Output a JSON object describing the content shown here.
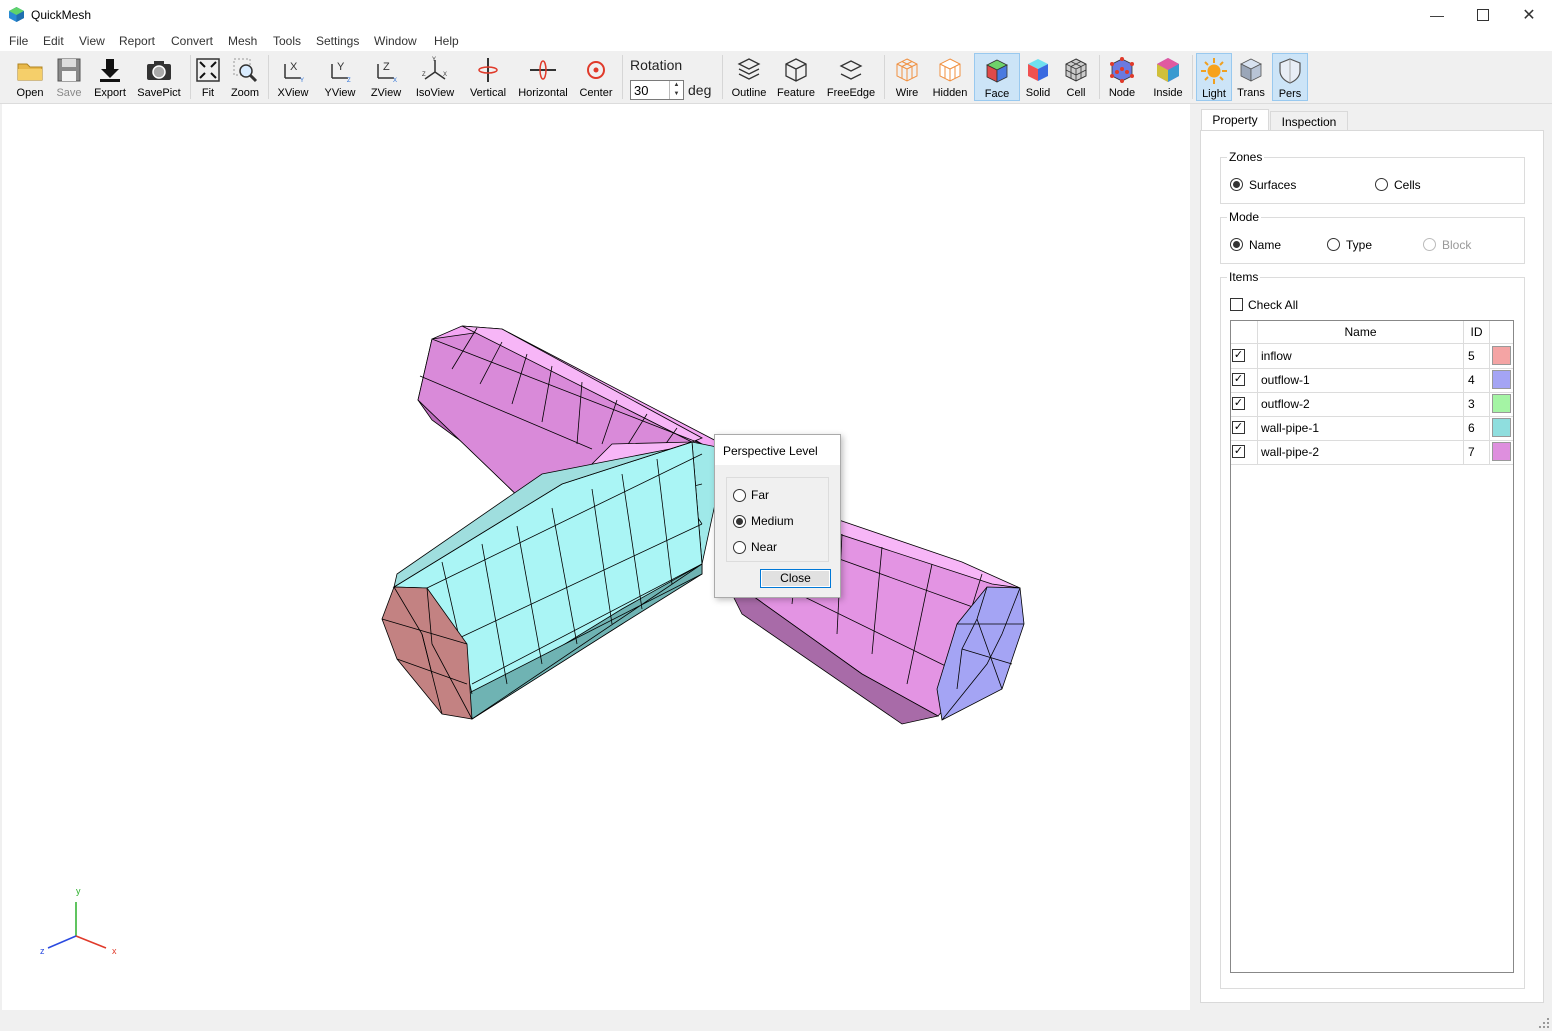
{
  "window": {
    "title": "QuickMesh",
    "min_icon": "minimize-icon",
    "max_icon": "maximize-icon",
    "close_icon": "close-icon"
  },
  "menu": [
    "File",
    "Edit",
    "View",
    "Report",
    "Convert",
    "Mesh",
    "Tools",
    "Settings",
    "Window",
    "Help"
  ],
  "toolbar": {
    "open": "Open",
    "save": "Save",
    "export": "Export",
    "savepict": "SavePict",
    "fit": "Fit",
    "zoom": "Zoom",
    "xview": "XView",
    "yview": "YView",
    "zview": "ZView",
    "isoview": "IsoView",
    "vertical": "Vertical",
    "horizontal": "Horizontal",
    "center": "Center",
    "rotation_label": "Rotation",
    "rotation_value": "30",
    "rotation_unit": "deg",
    "outline": "Outline",
    "feature": "Feature",
    "freeedge": "FreeEdge",
    "wire": "Wire",
    "hidden": "Hidden",
    "face": "Face",
    "solid": "Solid",
    "cell": "Cell",
    "node": "Node",
    "inside": "Inside",
    "light": "Light",
    "trans": "Trans",
    "pers": "Pers",
    "active": [
      "face",
      "light",
      "pers"
    ]
  },
  "axes": {
    "x": "x",
    "y": "y",
    "z": "z"
  },
  "dialog": {
    "title": "Perspective Level",
    "options": [
      "Far",
      "Medium",
      "Near"
    ],
    "selected": "Medium",
    "close_label": "Close"
  },
  "panel": {
    "tabs": [
      "Property",
      "Inspection"
    ],
    "selected_tab": "Property",
    "zones": {
      "label": "Zones",
      "options": [
        "Surfaces",
        "Cells"
      ],
      "selected": "Surfaces"
    },
    "mode": {
      "label": "Mode",
      "options": [
        "Name",
        "Type",
        "Block"
      ],
      "selected": "Name",
      "disabled": [
        "Block"
      ]
    },
    "items": {
      "label": "Items",
      "check_all": "Check All",
      "columns": {
        "name": "Name",
        "id": "ID"
      },
      "rows": [
        {
          "name": "inflow",
          "id": "5",
          "color": "#f4a4a4",
          "checked": true
        },
        {
          "name": "outflow-1",
          "id": "4",
          "color": "#a4a4f4",
          "checked": true
        },
        {
          "name": "outflow-2",
          "id": "3",
          "color": "#a4f4a4",
          "checked": true
        },
        {
          "name": "wall-pipe-1",
          "id": "6",
          "color": "#8fdede",
          "checked": true
        },
        {
          "name": "wall-pipe-2",
          "id": "7",
          "color": "#de8fde",
          "checked": true
        }
      ]
    }
  },
  "colors": {
    "accent": "#0078d7",
    "pipe1": "#aaf5f5",
    "pipe2": "#f5a8f5",
    "inflow": "#c38282",
    "outflow1": "#a4a4f4"
  }
}
